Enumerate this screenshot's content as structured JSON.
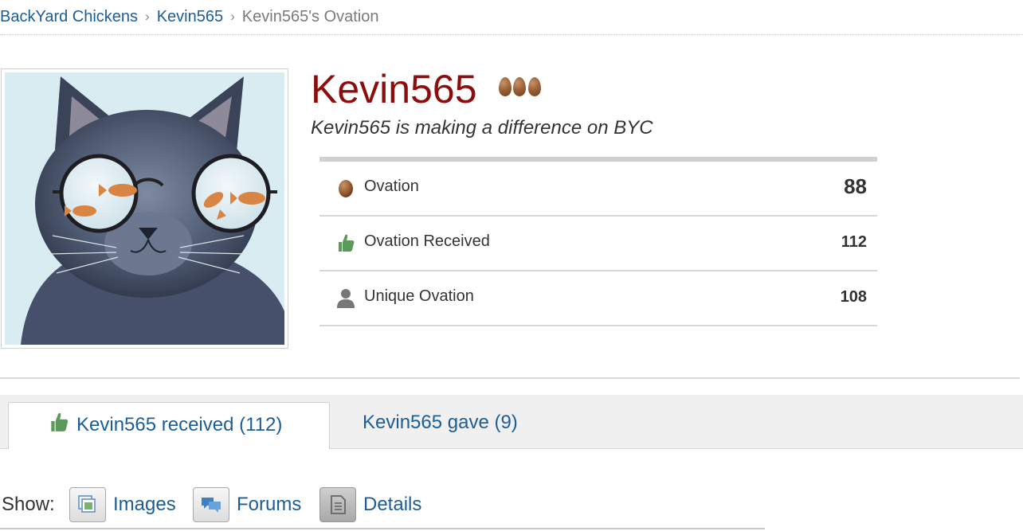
{
  "breadcrumb": {
    "items": [
      "BackYard Chickens",
      "Kevin565"
    ],
    "current": "Kevin565's Ovation",
    "separator": "›"
  },
  "profile": {
    "username": "Kevin565",
    "tagline": "Kevin565 is making a difference on BYC",
    "avatar": "cat-with-fishbowl-glasses"
  },
  "stats": [
    {
      "icon": "egg-icon",
      "label": "Ovation",
      "value": "88"
    },
    {
      "icon": "thumbs-up-icon",
      "label": "Ovation Received",
      "value": "112"
    },
    {
      "icon": "person-icon",
      "label": "Unique Ovation",
      "value": "108"
    }
  ],
  "tabs": [
    {
      "label": "Kevin565 received (112)",
      "active": true
    },
    {
      "label": "Kevin565 gave (9)",
      "active": false
    }
  ],
  "show": {
    "label": "Show:",
    "filters": [
      {
        "label": "Images",
        "icon": "images-icon"
      },
      {
        "label": "Forums",
        "icon": "forums-icon"
      },
      {
        "label": "Details",
        "icon": "details-icon"
      }
    ]
  },
  "colors": {
    "link": "#1d5d96",
    "username": "#8b0d0d",
    "thumb": "#5a9a5a",
    "egg": "#9c6238"
  }
}
